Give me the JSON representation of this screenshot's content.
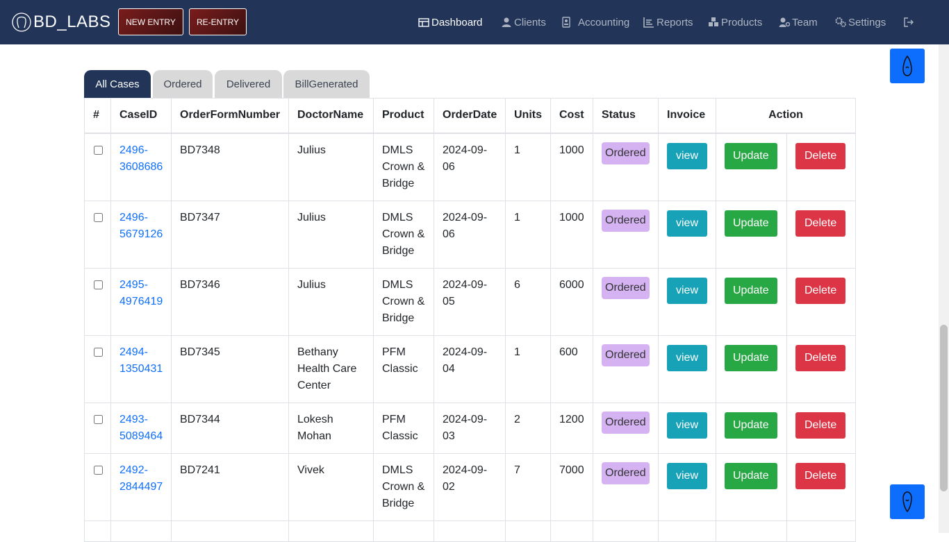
{
  "app": {
    "brand": "BD_LABS"
  },
  "toolbar": {
    "new_entry": "NEW ENTRY",
    "re_entry": "RE-ENTRY"
  },
  "nav": {
    "dashboard": "Dashboard",
    "clients": "Clients",
    "accounting": "Accounting",
    "reports": "Reports",
    "products": "Products",
    "team": "Team",
    "settings": "Settings"
  },
  "tabs": [
    "All Cases",
    "Ordered",
    "Delivered",
    "BillGenerated"
  ],
  "table": {
    "headers": [
      "#",
      "CaseID",
      "OrderFormNumber",
      "DoctorName",
      "Product",
      "OrderDate",
      "Units",
      "Cost",
      "Status",
      "Invoice",
      "Action"
    ],
    "view_label": "view",
    "update_label": "Update",
    "delete_label": "Delete",
    "rows": [
      {
        "case_id": "2496-\n3608686",
        "order_form": "BD7348",
        "doctor": "Julius",
        "product": "DMLS Crown & Bridge",
        "date": "2024-09-06",
        "units": "1",
        "cost": "1000",
        "status": "Ordered"
      },
      {
        "case_id": "2496-\n5679126",
        "order_form": "BD7347",
        "doctor": "Julius",
        "product": "DMLS Crown & Bridge",
        "date": "2024-09-06",
        "units": "1",
        "cost": "1000",
        "status": "Ordered"
      },
      {
        "case_id": "2495-\n4976419",
        "order_form": "BD7346",
        "doctor": "Julius",
        "product": "DMLS Crown & Bridge",
        "date": "2024-09-05",
        "units": "6",
        "cost": "6000",
        "status": "Ordered"
      },
      {
        "case_id": "2494-\n1350431",
        "order_form": "BD7345",
        "doctor": "Bethany Health Care Center",
        "product": "PFM Classic",
        "date": "2024-09-04",
        "units": "1",
        "cost": "600",
        "status": "Ordered"
      },
      {
        "case_id": "2493-\n5089464",
        "order_form": "BD7344",
        "doctor": "Lokesh Mohan",
        "product": "PFM Classic",
        "date": "2024-09-03",
        "units": "2",
        "cost": "1200",
        "status": "Ordered"
      },
      {
        "case_id": "2492-\n2844497",
        "order_form": "BD7241",
        "doctor": "Vivek",
        "product": "DMLS Crown & Bridge",
        "date": "2024-09-02",
        "units": "7",
        "cost": "7000",
        "status": "Ordered"
      }
    ]
  },
  "colors": {
    "navbar": "#223559",
    "primary": "#0d6efd",
    "view": "#17a2b8",
    "update": "#28a745",
    "delete": "#dc3545",
    "status_badge": "#d5b3f3"
  }
}
